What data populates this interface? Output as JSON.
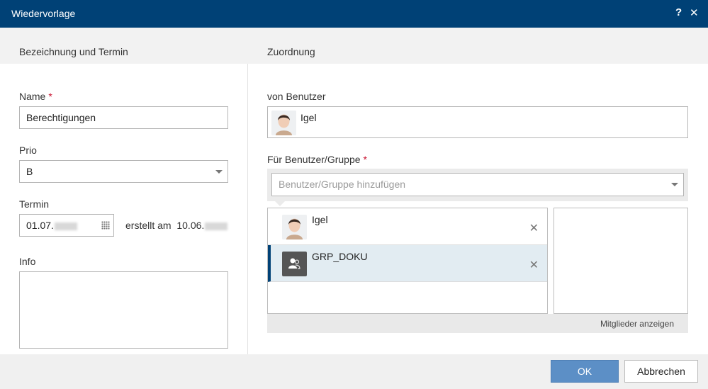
{
  "dialog": {
    "title": "Wiedervorlage",
    "help_icon": "?",
    "close_icon": "✕"
  },
  "left": {
    "section_title": "Bezeichnung und Termin",
    "name_label": "Name",
    "required_mark": "*",
    "name_value": "Berechtigungen",
    "prio_label": "Prio",
    "prio_value": "B",
    "termin_label": "Termin",
    "termin_value": "01.07.",
    "created_prefix": "erstellt am",
    "created_value": "10.06.",
    "info_label": "Info",
    "info_value": ""
  },
  "right": {
    "section_title": "Zuordnung",
    "from_user_label": "von Benutzer",
    "from_user_value": "Igel",
    "for_label": "Für Benutzer/Gruppe",
    "required_mark": "*",
    "add_placeholder": "Benutzer/Gruppe hinzufügen",
    "assignees": [
      {
        "name": "Igel",
        "type": "user",
        "remove_icon": "✕"
      },
      {
        "name": "GRP_DOKU",
        "type": "group",
        "remove_icon": "✕"
      }
    ],
    "members_button": "Mitglieder anzeigen"
  },
  "footer": {
    "ok_label": "OK",
    "cancel_label": "Abbrechen"
  },
  "colors": {
    "titlebar": "#004176",
    "primary_button": "#5c8fc6",
    "required": "#c8102e",
    "selected_row": "#e2ecf2"
  }
}
